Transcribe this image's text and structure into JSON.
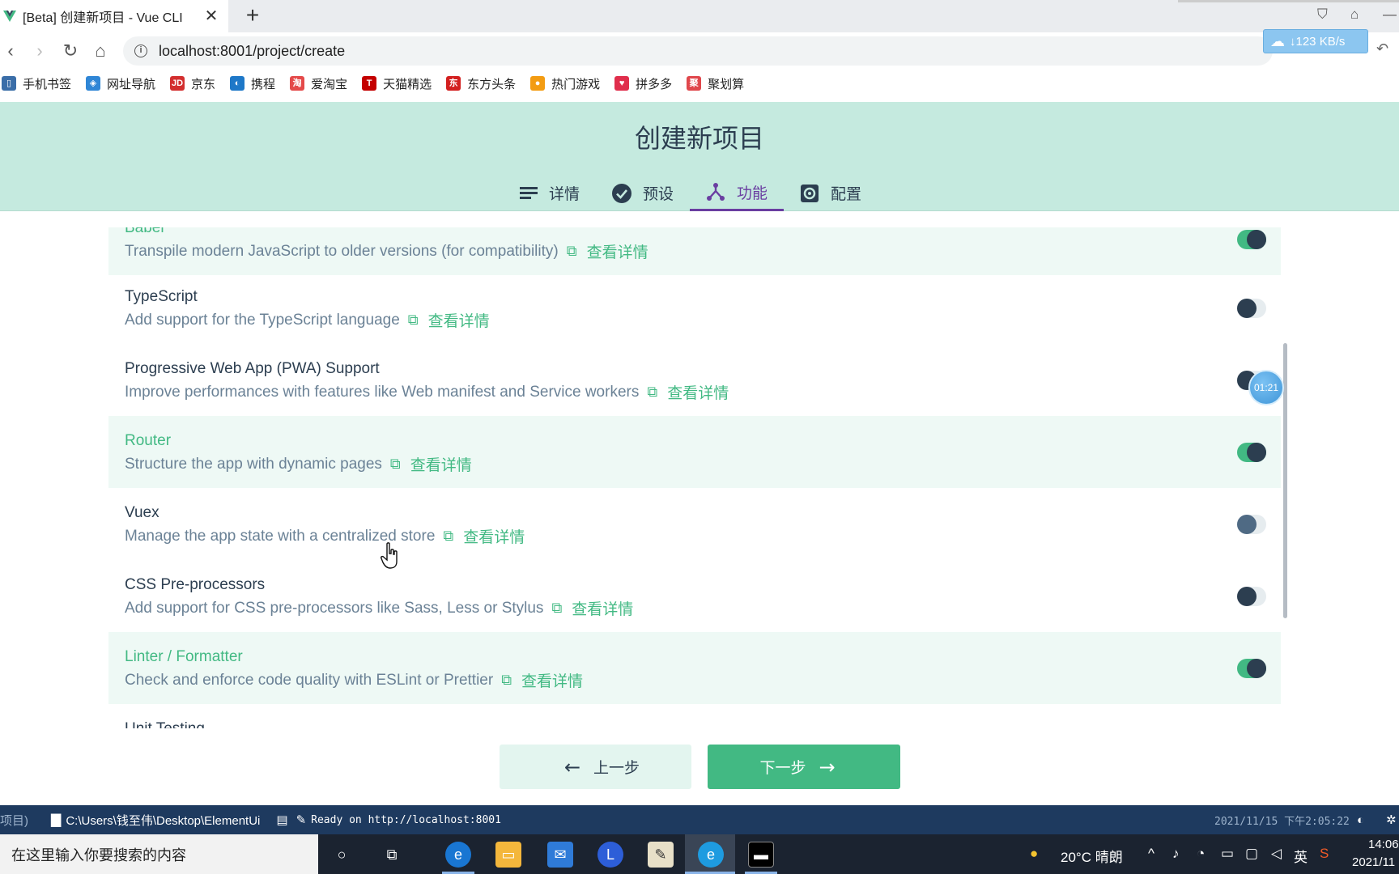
{
  "browser": {
    "tab_title": "[Beta] 创建新项目 - Vue CLI",
    "tab_close": "✕",
    "new_tab": "+",
    "url": "localhost:8001/project/create",
    "speed": "↓123 KB/s"
  },
  "bookmarks": [
    {
      "label": "手机书签",
      "color": "#3b6ea8",
      "icon": "mobile-bookmark-icon",
      "glyph": "▯"
    },
    {
      "label": "网址导航",
      "color": "#2f86d6",
      "icon": "navigation-icon",
      "glyph": "◈"
    },
    {
      "label": "京东",
      "color": "#d32f2f",
      "icon": "jd-icon",
      "glyph": "JD"
    },
    {
      "label": "携程",
      "color": "#1e78c8",
      "icon": "ctrip-icon",
      "glyph": "◐"
    },
    {
      "label": "爱淘宝",
      "color": "#e44a4a",
      "icon": "aitaobao-icon",
      "glyph": "淘"
    },
    {
      "label": "天猫精选",
      "color": "#c40000",
      "icon": "tmall-icon",
      "glyph": "T"
    },
    {
      "label": "东方头条",
      "color": "#d32020",
      "icon": "toutiao-icon",
      "glyph": "东"
    },
    {
      "label": "热门游戏",
      "color": "#f39c12",
      "icon": "games-icon",
      "glyph": "●"
    },
    {
      "label": "拼多多",
      "color": "#e02e4c",
      "icon": "pinduoduo-icon",
      "glyph": "♥"
    },
    {
      "label": "聚划算",
      "color": "#e0474c",
      "icon": "juhuasuan-icon",
      "glyph": "聚"
    }
  ],
  "header": {
    "title": "创建新项目",
    "steps": [
      {
        "label": "详情",
        "icon": "list-icon",
        "active": false
      },
      {
        "label": "预设",
        "icon": "check-circle-icon",
        "active": false
      },
      {
        "label": "功能",
        "icon": "fork-icon",
        "active": true
      },
      {
        "label": "配置",
        "icon": "gear-icon",
        "active": false
      }
    ]
  },
  "features": [
    {
      "name": "Babel",
      "desc": "Transpile modern JavaScript to older versions (for compatibility)",
      "link": "查看详情",
      "enabled": true,
      "selected": true,
      "partial": true
    },
    {
      "name": "TypeScript",
      "desc": "Add support for the TypeScript language",
      "link": "查看详情",
      "enabled": false,
      "selected": false
    },
    {
      "name": "Progressive Web App (PWA) Support",
      "desc": "Improve performances with features like Web manifest and Service workers",
      "link": "查看详情",
      "enabled": false,
      "selected": false
    },
    {
      "name": "Router",
      "desc": "Structure the app with dynamic pages",
      "link": "查看详情",
      "enabled": true,
      "selected": true
    },
    {
      "name": "Vuex",
      "desc": "Manage the app state with a centralized store",
      "link": "查看详情",
      "enabled": false,
      "selected": false,
      "hover": true
    },
    {
      "name": "CSS Pre-processors",
      "desc": "Add support for CSS pre-processors like Sass, Less or Stylus",
      "link": "查看详情",
      "enabled": false,
      "selected": false
    },
    {
      "name": "Linter / Formatter",
      "desc": "Check and enforce code quality with ESLint or Prettier",
      "link": "查看详情",
      "enabled": true,
      "selected": true
    },
    {
      "name": "Unit Testing",
      "desc": "",
      "link": "",
      "enabled": false,
      "selected": false,
      "partial": true
    }
  ],
  "timer": "01:21",
  "actions": {
    "prev_label": "上一步",
    "next_label": "下一步"
  },
  "status": {
    "left": "项目)",
    "path": "C:\\Users\\钱至伟\\Desktop\\ElementUi",
    "message": "Ready on http://localhost:8001",
    "timestamp": "2021/11/15 下午2:05:22"
  },
  "taskbar": {
    "search_placeholder": "在这里输入你要搜索的内容",
    "weather": "20°C 晴朗",
    "ime": "英",
    "time": "14:06",
    "date": "2021/11"
  }
}
